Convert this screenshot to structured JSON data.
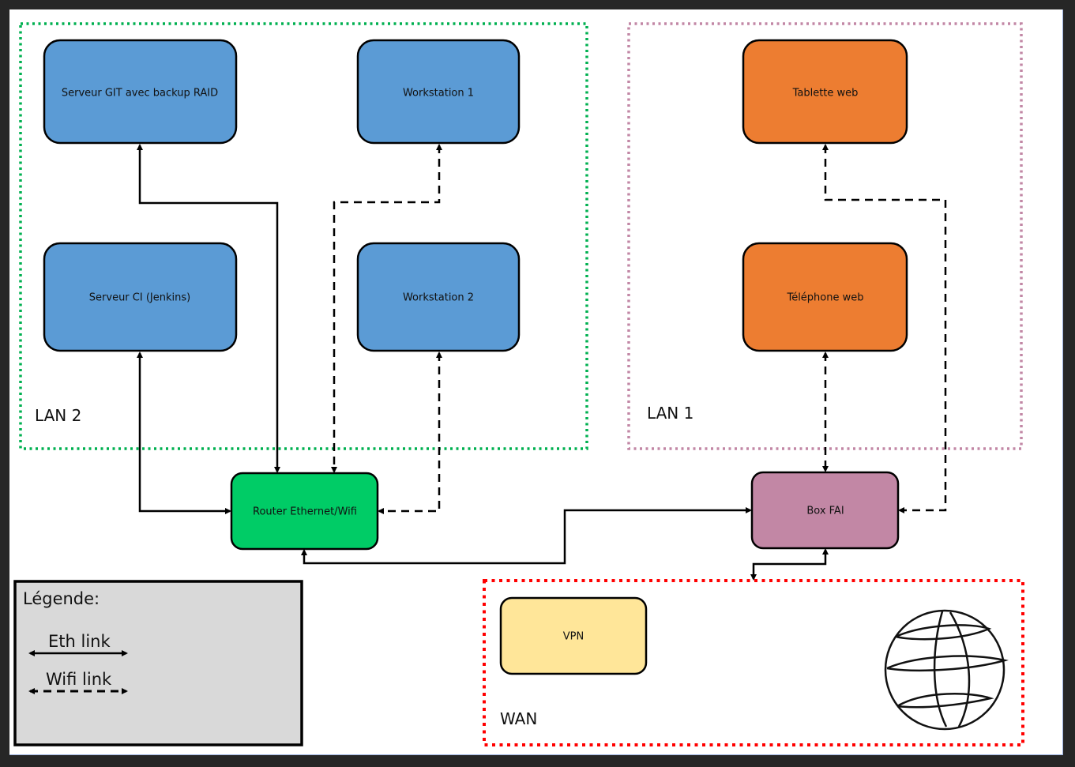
{
  "zones": {
    "lan2": {
      "label": "LAN 2",
      "color": "#00b050"
    },
    "lan1": {
      "label": "LAN 1",
      "color": "#c287a5"
    },
    "wan": {
      "label": "WAN",
      "color": "#ff0000"
    }
  },
  "nodes": {
    "git": {
      "label": "Serveur GIT avec backup RAID",
      "color": "#5b9bd5"
    },
    "ws1": {
      "label": "Workstation 1",
      "color": "#5b9bd5"
    },
    "ci": {
      "label": "Serveur CI (Jenkins)",
      "color": "#5b9bd5"
    },
    "ws2": {
      "label": "Workstation 2",
      "color": "#5b9bd5"
    },
    "tablet": {
      "label": "Tablette web",
      "color": "#ed7d31"
    },
    "phone": {
      "label": "Téléphone web",
      "color": "#ed7d31"
    },
    "router": {
      "label": "Router Ethernet/Wifi",
      "color": "#00cc66"
    },
    "box": {
      "label": "Box FAI",
      "color": "#c287a5"
    },
    "vpn": {
      "label": "VPN",
      "color": "#ffe699"
    }
  },
  "globe_icon": "globe-icon",
  "legend": {
    "title": "Légende:",
    "eth": "Eth link",
    "wifi": "Wifi link"
  }
}
